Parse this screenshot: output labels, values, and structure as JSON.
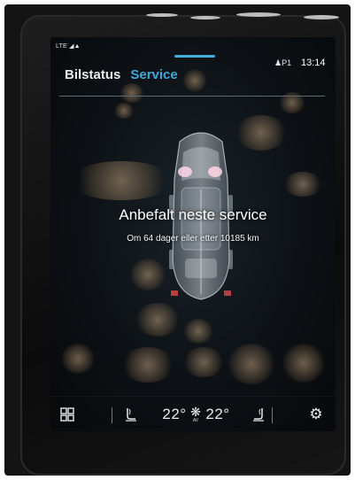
{
  "status_bar": {
    "signal": "LTE",
    "profile": "P1",
    "time": "13:14"
  },
  "tabs": [
    {
      "label": "Bilstatus",
      "active": false
    },
    {
      "label": "Service",
      "active": true
    }
  ],
  "service": {
    "headline": "Anbefalt neste service",
    "detail": "Om 64 dager eller etter 10185 km"
  },
  "climate": {
    "left_temp": "22°",
    "right_temp": "22°",
    "fan_label": "AV"
  },
  "icons": {
    "home": "grid-icon",
    "left_seat": "seat-heat-left-icon",
    "fan": "fan-icon",
    "right_seat": "seat-heat-right-icon",
    "settings": "gear-icon",
    "user": "user-icon",
    "handle": "pull-down-handle"
  },
  "colors": {
    "accent": "#3fa9d8",
    "screen_bg": "#0c1014",
    "text": "#ffffff"
  }
}
